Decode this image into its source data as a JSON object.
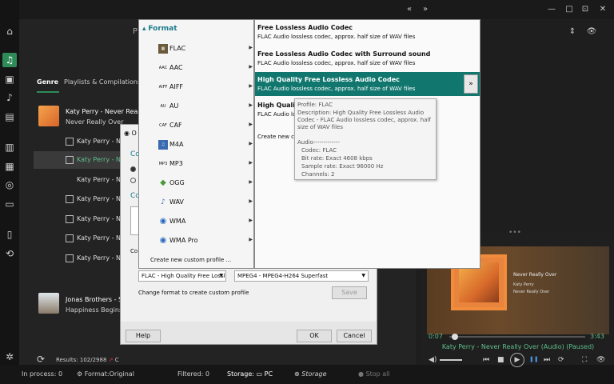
{
  "sidebar": {
    "icons": [
      "home-icon",
      "music-icon",
      "radio-icon",
      "podcast-music-icon",
      "document-icon",
      "film-icon",
      "video-convert-icon",
      "broadcast-icon",
      "monitor-icon",
      "file-icon",
      "sync-icon",
      "settings-icon"
    ]
  },
  "topbar": {
    "nav_prev": "«",
    "nav_next": "»",
    "top_letter": "P",
    "sort": "⇕",
    "eye": "👁",
    "minimize": "—",
    "maximize": "□",
    "restore": "⊡",
    "close": "✕"
  },
  "library": {
    "tabs": [
      "Genre",
      "Playlists & Compilations"
    ],
    "album1": {
      "title": "Katy Perry - Never Really",
      "sub": "Never Really Over"
    },
    "rows": [
      "Katy Perry - Nev",
      "Katy Perry - Nev",
      "Katy Perry - Never",
      "Katy Perry - Nev",
      "Katy Perry - Nev",
      "Katy Perry - Nev",
      "Katy Perry - Nev"
    ],
    "album2": {
      "title": "Jonas Brothers - Su",
      "sub": "Happiness Begins"
    },
    "results": "Results: 102/2988",
    "results_extra": "C"
  },
  "statusbar": {
    "in_process": "In process: 0",
    "format": "Format:Original",
    "filtered": "Filtered: 0",
    "storage_label": "Storage:",
    "storage_value": "PC",
    "add_storage": "Storage",
    "stop_all": "Stop all"
  },
  "player": {
    "np_title": "Never Really Over",
    "np_artist": "Katy Perry",
    "np_album": "Never Really Over",
    "time_elapsed": "0:07",
    "time_total": "3:43",
    "progress": 0.03,
    "caption": "Katy Perry - Never Really Over (Audio) (Paused)",
    "controls": {
      "volume": "◀)",
      "prev": "⏮",
      "stop": "■",
      "play": "▶",
      "pause": "❚❚",
      "next": "⏭",
      "repeat": "⟳",
      "fullscreen": "⛶",
      "eye": "👁"
    },
    "dots": "•••"
  },
  "dialog": {
    "label_o": "O",
    "label_co1": "Co",
    "label_co2": "Co",
    "label_co3": "Co",
    "audio_combo": "FLAC - High Quality Free Lossle",
    "video_combo": "MPEG4 - MPEG4-H264 Superfast",
    "change_format": "Change format to create custom profile",
    "save": "Save",
    "help": "Help",
    "ok": "OK",
    "cancel": "Cancel"
  },
  "format_menu": {
    "header": "Format",
    "items": [
      {
        "label": "FLAC",
        "icon": "flac-icon",
        "abbr": "▦"
      },
      {
        "label": "AAC",
        "icon": "aac-icon",
        "abbr": "AAC"
      },
      {
        "label": "AIFF",
        "icon": "aiff-icon",
        "abbr": "AIFF"
      },
      {
        "label": "AU",
        "icon": "au-icon",
        "abbr": "AU"
      },
      {
        "label": "CAF",
        "icon": "caf-icon",
        "abbr": "CAF"
      },
      {
        "label": "M4A",
        "icon": "m4a-icon",
        "abbr": "♫"
      },
      {
        "label": "MP3",
        "icon": "mp3-icon",
        "abbr": "MP3"
      },
      {
        "label": "OGG",
        "icon": "ogg-icon",
        "abbr": "◆"
      },
      {
        "label": "WAV",
        "icon": "wav-icon",
        "abbr": "♪"
      },
      {
        "label": "WMA",
        "icon": "wma-icon",
        "abbr": "◉"
      },
      {
        "label": "WMA Pro",
        "icon": "wma-pro-icon",
        "abbr": "◉"
      }
    ],
    "create": "Create new custom profile ..."
  },
  "profile_menu": {
    "items": [
      {
        "title": "Free Lossless Audio Codec",
        "desc": "FLAC Audio lossless codec, approx. half size of WAV files"
      },
      {
        "title": "Free Lossless Audio Codec with Surround sound",
        "desc": "FLAC Audio lossless codec, approx. half size of WAV files"
      },
      {
        "title": "High Quality Free Lossless Audio Codec",
        "desc": "FLAC Audio lossless codec, approx. half size of WAV files"
      },
      {
        "title": "High Quality",
        "desc": "FLAC Audio lo"
      }
    ],
    "more": "»",
    "create": "Create new cus"
  },
  "tooltip": {
    "profile": "Profile: FLAC",
    "description": "Description: High Quality Free Lossless Audio Codec - FLAC Audio lossless codec, approx. half size of WAV files",
    "audio_header": "Audio-------------",
    "codec": "Codec: FLAC",
    "bitrate": "Bit rate: Exact 4608 kbps",
    "samplerate": "Sample rate: Exact 96000 Hz",
    "channels": "Channels: 2"
  }
}
